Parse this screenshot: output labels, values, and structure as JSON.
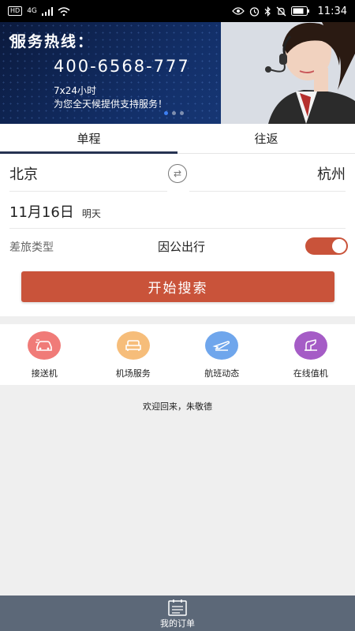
{
  "status_bar": {
    "left_badge": "HD",
    "network": "4G",
    "time": "11:34"
  },
  "banner": {
    "title": "服务热线：",
    "phone": "400-6568-777",
    "hours": "7x24小时",
    "description": "为您全天候提供支持服务！"
  },
  "tabs": [
    {
      "label": "单程",
      "active": true
    },
    {
      "label": "往返",
      "active": false
    }
  ],
  "route": {
    "from_city": "北京",
    "to_city": "杭州"
  },
  "date": {
    "main": "11月16日",
    "sub": "明天"
  },
  "trip_type": {
    "label": "差旅类型",
    "value": "因公出行",
    "toggle_on": true
  },
  "search_button": "开始搜索",
  "services": [
    {
      "label": "接送机",
      "icon": "car-icon",
      "color": "#f07b78"
    },
    {
      "label": "机场服务",
      "icon": "sofa-icon",
      "color": "#f6bd7a"
    },
    {
      "label": "航班动态",
      "icon": "plane-icon",
      "color": "#6fa6ec"
    },
    {
      "label": "在线值机",
      "icon": "checkin-icon",
      "color": "#a55cc6"
    }
  ],
  "welcome": "欢迎回来，朱敬德",
  "bottom_nav": {
    "orders_label": "我的订单"
  },
  "colors": {
    "accent": "#c9533a",
    "tab_indicator": "#263352",
    "bottom_bar": "#5c6878"
  }
}
